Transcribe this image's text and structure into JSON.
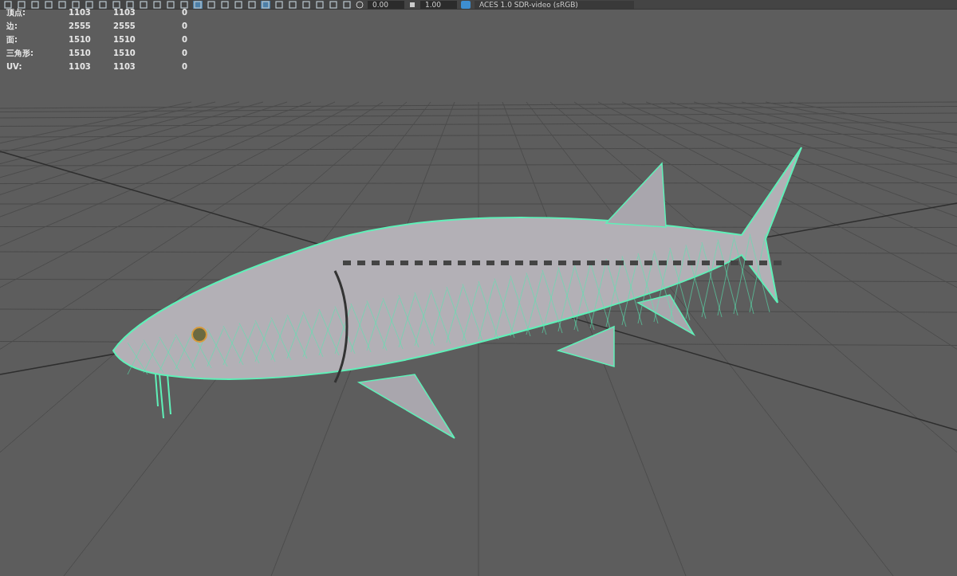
{
  "toolbar": {
    "exposure": "0.00",
    "gamma": "1.00",
    "color_space": "ACES 1.0 SDR-video (sRGB)"
  },
  "poly_count": [
    {
      "label": "顶点:",
      "values": [
        "1103",
        "1103",
        "0"
      ]
    },
    {
      "label": "边:",
      "values": [
        "2555",
        "2555",
        "0"
      ]
    },
    {
      "label": "面:",
      "values": [
        "1510",
        "1510",
        "0"
      ]
    },
    {
      "label": "三角形:",
      "values": [
        "1510",
        "1510",
        "0"
      ]
    },
    {
      "label": "UV:",
      "values": [
        "1103",
        "1103",
        "0"
      ]
    }
  ]
}
